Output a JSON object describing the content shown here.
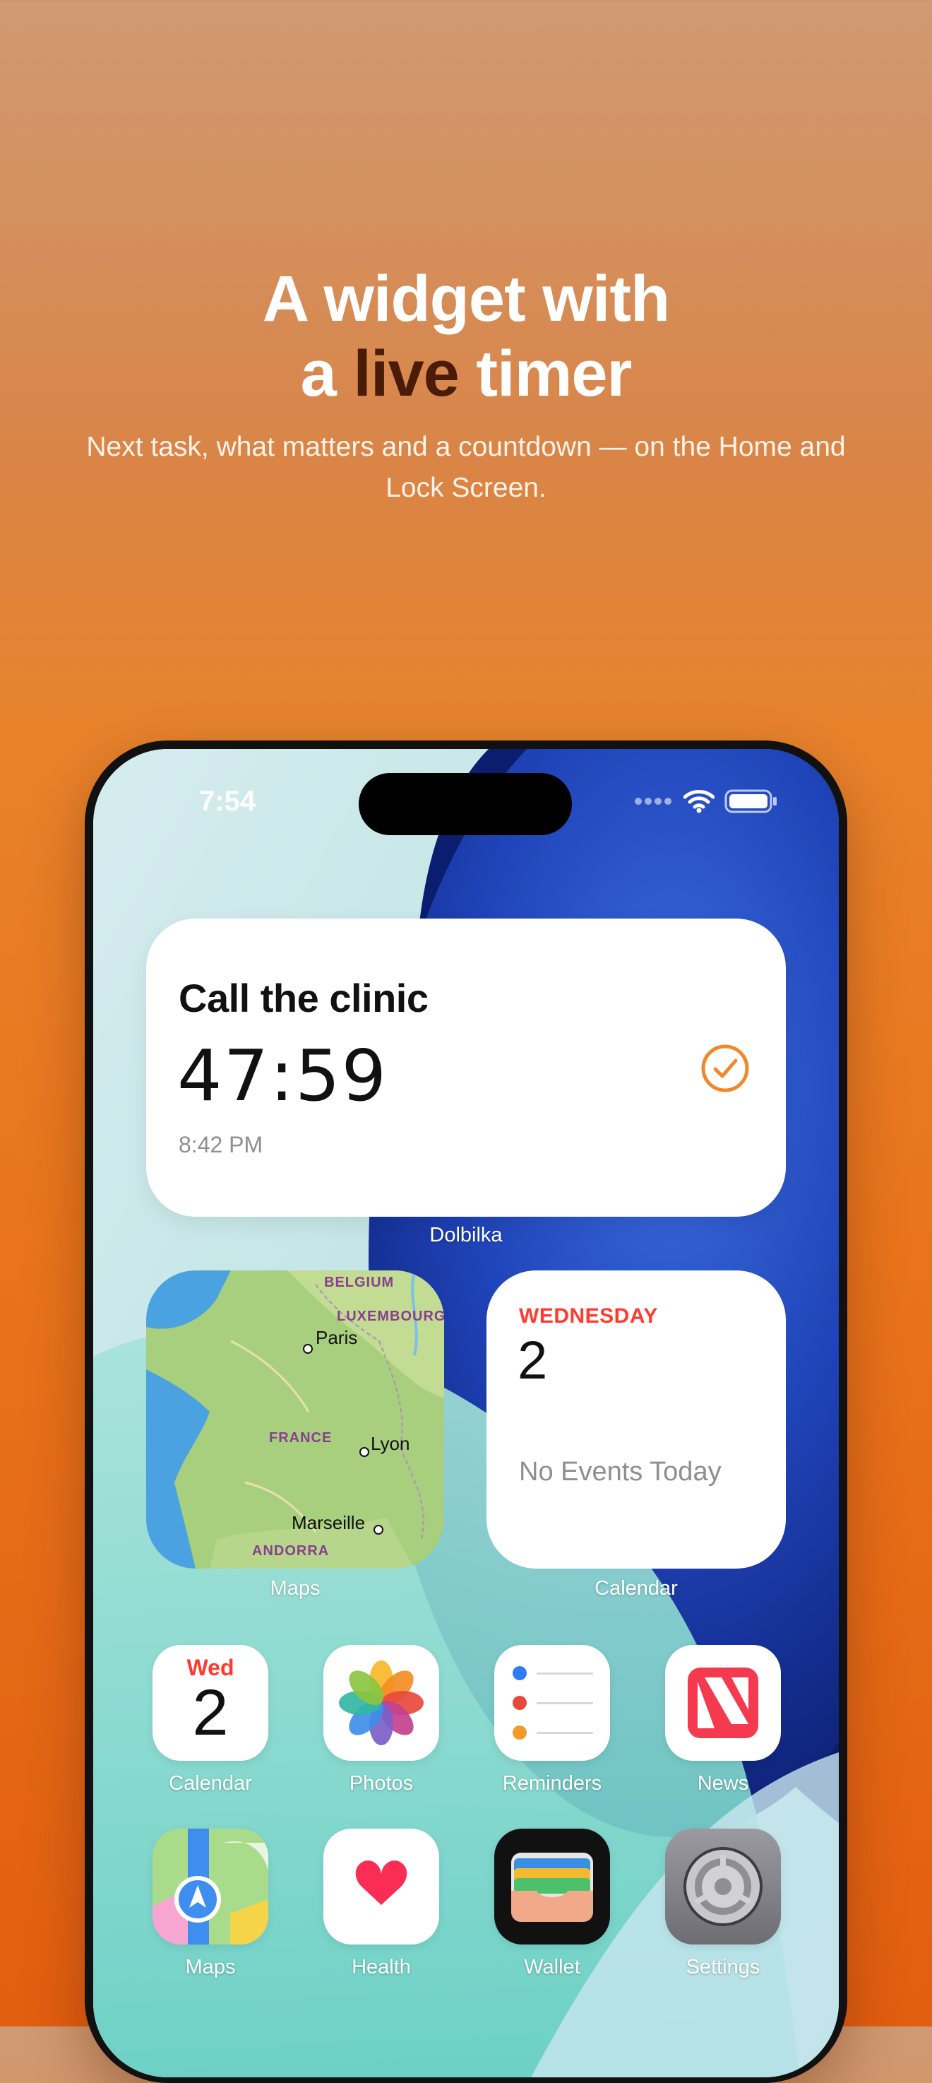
{
  "headline": {
    "line1": "A widget with",
    "line2_prefix": "a ",
    "line2_accent": "live",
    "line2_suffix": " timer"
  },
  "subtitle": "Next task, what matters and a countdown — on the Home and Lock Screen.",
  "status_bar": {
    "time": "7:54",
    "icons": [
      "cellular-dots-icon",
      "wifi-icon",
      "battery-icon"
    ]
  },
  "task_widget": {
    "title": "Call the clinic",
    "timer": "47:59",
    "due_time": "8:42 PM",
    "icon": "checkmark-circle-icon",
    "label": "Dolbilka"
  },
  "maps_widget": {
    "label": "Maps",
    "places": {
      "belgium": "BELGIUM",
      "luxembourg": "LUXEMBOURG",
      "paris": "Paris",
      "france": "FRANCE",
      "lyon": "Lyon",
      "marseille": "Marseille",
      "andorra": "ANDORRA"
    }
  },
  "calendar_widget": {
    "weekday": "WEDNESDAY",
    "date": "2",
    "events": "No Events Today",
    "label": "Calendar"
  },
  "apps": [
    {
      "label": "Calendar",
      "icon": "calendar-icon",
      "weekday": "Wed",
      "day": "2"
    },
    {
      "label": "Photos",
      "icon": "photos-icon"
    },
    {
      "label": "Reminders",
      "icon": "reminders-icon"
    },
    {
      "label": "News",
      "icon": "news-icon"
    },
    {
      "label": "Maps",
      "icon": "maps-icon"
    },
    {
      "label": "Health",
      "icon": "health-icon"
    },
    {
      "label": "Wallet",
      "icon": "wallet-icon"
    },
    {
      "label": "Settings",
      "icon": "settings-icon"
    }
  ],
  "colors": {
    "accent_orange": "#f0892b",
    "headline_accent": "#4a1c08",
    "calendar_red": "#ff3b30"
  }
}
